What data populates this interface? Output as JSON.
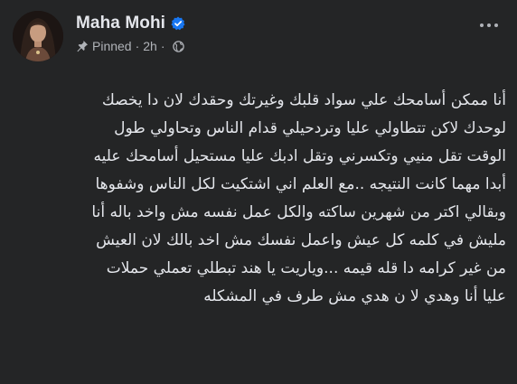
{
  "post": {
    "author": "Maha Mohi",
    "verified_icon": "verified-badge-icon",
    "pinned_label": "Pinned",
    "separator": "·",
    "time": "2h",
    "separator2": "·",
    "audience_icon": "globe-icon",
    "more_icon": "more-options-icon",
    "lines": [
      "أنا ممكن أسامحك علي سواد قلبك وغيرتك وحقدك لان  دا يخصك",
      "لوحدك لاكن تتطاولي عليا وتردحيلي قدام الناس  وتحاولي طول",
      "الوقت تقل منيي وتكسرني وتقل ادبك عليا مستحيل أسامحك عليه",
      "أبدا مهما كانت النتيجه ..مع العلم اني اشتكيت لكل الناس وشفوها",
      "وبقالي اكتر من شهرين ساكته والكل عمل نفسه مش واخد باله أنا",
      "مليش في كلمه كل عيش واعمل نفسك مش اخد بالك لان العيش",
      "من غير كرامه دا قله قيمه   ...وياريت يا هند تبطلي تعملي حملات",
      "عليا أنا وهدي لا ن  هدي مش طرف في المشكله"
    ]
  },
  "colors": {
    "background": "#242526",
    "text_primary": "#e4e6eb",
    "text_secondary": "#b0b3b8",
    "verified_blue": "#1877f2"
  }
}
